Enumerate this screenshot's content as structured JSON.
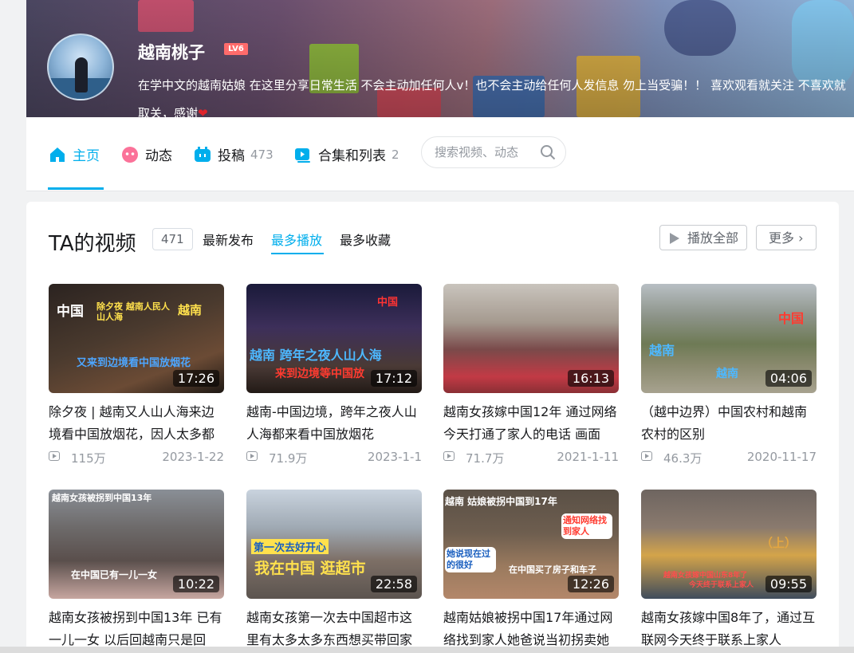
{
  "profile": {
    "name": "越南桃子",
    "level": "LV6",
    "sign": "在学中文的越南姑娘 在这里分享日常生活 不会主动加任何人v！也不会主动给任何人发信息 勿上当受骗！！ 喜欢观看就关注 不喜欢就取关，感谢",
    "sign_heart": "❤"
  },
  "nav": {
    "items": [
      {
        "label": "主页",
        "count": "",
        "icon": "home-icon"
      },
      {
        "label": "动态",
        "count": "",
        "icon": "dynamic-icon"
      },
      {
        "label": "投稿",
        "count": "473",
        "icon": "upload-icon"
      },
      {
        "label": "合集和列表",
        "count": "2",
        "icon": "collection-icon"
      }
    ],
    "search_placeholder": "搜索视频、动态"
  },
  "videos": {
    "title": "TA的视频",
    "count": "471",
    "sorts": [
      "最新发布",
      "最多播放",
      "最多收藏"
    ],
    "active_sort": "最多播放",
    "play_all": "播放全部",
    "more": "更多",
    "items": [
      {
        "title": "除夕夜 | 越南又人山人海来边境看中国放烟花，因人太多都",
        "views": "115万",
        "date": "2023-1-22",
        "duration": "17:26",
        "captions": [
          "中国",
          "除夕夜 越南人民人山人海",
          "越南",
          "又来到边境看中国放烟花"
        ]
      },
      {
        "title": "越南-中国边境，跨年之夜人山人海都来看中国放烟花",
        "views": "71.9万",
        "date": "2023-1-1",
        "duration": "17:12",
        "captions": [
          "中国",
          "越南 跨年之夜人山人海",
          "来到边境等中国放"
        ]
      },
      {
        "title": "越南女孩嫁中国12年 通过网络今天打通了家人的电话 画面",
        "views": "71.7万",
        "date": "2021-1-11",
        "duration": "16:13",
        "captions": []
      },
      {
        "title": "（越中边界）中国农村和越南农村的区别",
        "views": "46.3万",
        "date": "2020-11-17",
        "duration": "04:06",
        "captions": [
          "中国",
          "越南",
          "越南"
        ]
      },
      {
        "title": "越南女孩被拐到中国13年 已有一儿一女 以后回越南只是回",
        "views": "",
        "date": "",
        "duration": "10:22",
        "captions": [
          "越南女孩被拐到中国13年",
          "在中国已有一儿一女"
        ]
      },
      {
        "title": "越南女孩第一次去中国超市这里有太多太多东西想买带回家",
        "views": "",
        "date": "",
        "duration": "22:58",
        "captions": [
          "第一次去好开心",
          "我在中国 逛超市"
        ]
      },
      {
        "title": "越南姑娘被拐中国17年通过网络找到家人她爸说当初拐卖她",
        "views": "",
        "date": "",
        "duration": "12:26",
        "captions": [
          "越南 姑娘被拐中国到17年",
          "通知网络找到家人",
          "她说现在过的很好",
          "在中国买了房子和车子"
        ]
      },
      {
        "title": "越南女孩嫁中国8年了，通过互联网今天终于联系上家人",
        "views": "",
        "date": "",
        "duration": "09:55",
        "captions": [
          "（上）",
          "越南女孩嫁中国山东8年了",
          "今天终于联系上家人"
        ]
      }
    ]
  },
  "colors": {
    "accent": "#00aeec",
    "level_badge": "#ff6b6b",
    "text_secondary": "#9499a0"
  }
}
